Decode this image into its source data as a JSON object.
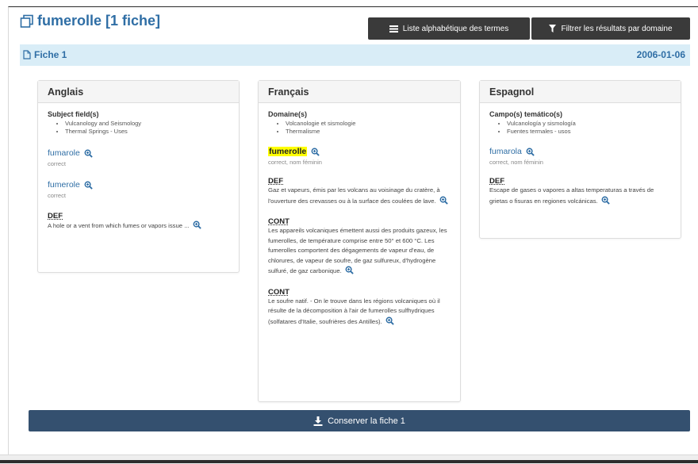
{
  "header": {
    "title": "fumerolle [1 fiche]",
    "btn_list": "Liste alphabétique des termes",
    "btn_filter": "Filtrer les résultats par domaine"
  },
  "fiche": {
    "label": "Fiche 1",
    "date": "2006-01-06"
  },
  "anglais": {
    "heading": "Anglais",
    "section": "Subject field(s)",
    "domains": [
      "Vulcanology and Seismology",
      "Thermal Springs - Uses"
    ],
    "terms": [
      {
        "term": "fumarole",
        "meta": "correct"
      },
      {
        "term": "fumerole",
        "meta": "correct"
      }
    ],
    "def_label": "DEF",
    "def_text": "A hole or a vent from which fumes or vapors issue ..."
  },
  "francais": {
    "heading": "Français",
    "section": "Domaine(s)",
    "domains": [
      "Volcanologie et sismologie",
      "Thermalisme"
    ],
    "term": "fumerolle",
    "meta": "correct, nom féminin",
    "def_label": "DEF",
    "def_text": "Gaz et vapeurs, émis par les volcans au voisinage du cratère, à l'ouverture des crevasses ou à la surface des coulées de lave.",
    "cont1_label": "CONT",
    "cont1_text": "Les appareils volcaniques émettent aussi des produits gazeux, les fumerolles, de température comprise entre 50° et 600 °C. Les fumerolles comportent des dégagements de vapeur d'eau, de chlorures, de vapeur de soufre, de gaz sulfureux, d'hydrogène sulfuré, de gaz carbonique.",
    "cont2_label": "CONT",
    "cont2_text": "Le soufre natif. - On le trouve dans les régions volcaniques où il résulte de la décomposition à l'air de fumerolles sulfhydriques (solfatares d'Italie, soufrières des Antilles)."
  },
  "espagnol": {
    "heading": "Espagnol",
    "section": "Campo(s) temático(s)",
    "domains": [
      "Vulcanología y sismología",
      "Fuentes termales - usos"
    ],
    "term": "fumarola",
    "meta": "correct, nom féminin",
    "def_label": "DEF",
    "def_text": "Escape de gases o vapores a altas temperaturas a través de grietas o fisuras en regiones volcánicas."
  },
  "footer": {
    "save": "Conserver la fiche 1"
  },
  "colors": {
    "link": "#2f6ea5",
    "bar": "#d9edf7",
    "save": "#34506f",
    "highlight": "#ffff00"
  }
}
